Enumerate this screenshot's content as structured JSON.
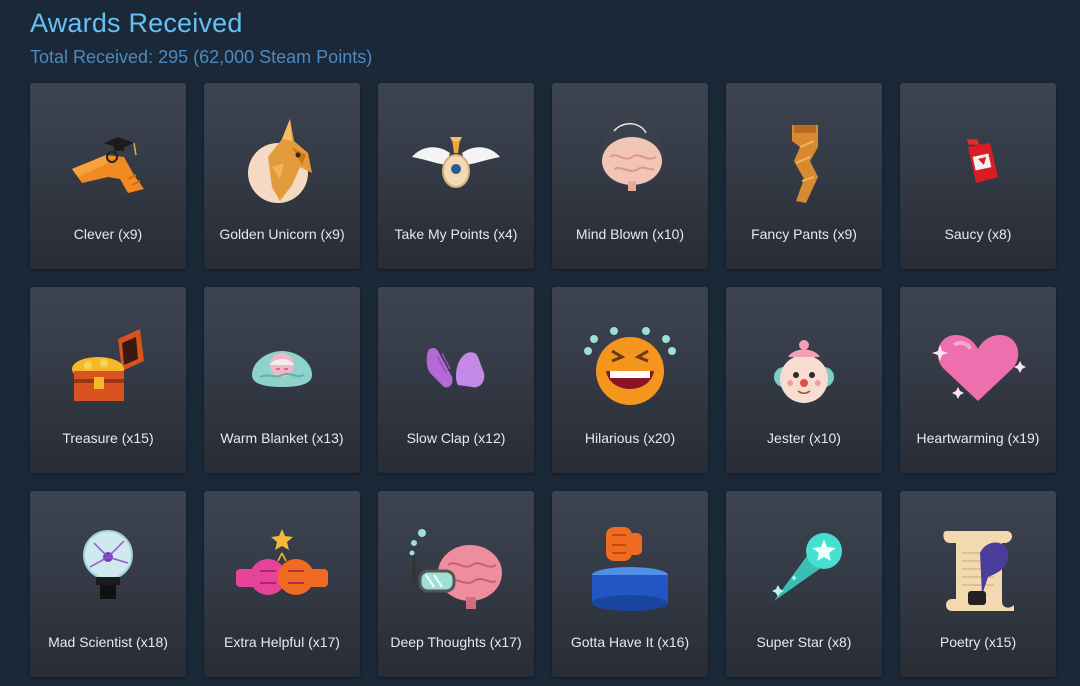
{
  "header": {
    "title": "Awards Received",
    "total": "Total Received: 295 (62,000 Steam Points)"
  },
  "awards": [
    {
      "label": "Clever (x9)",
      "icon": "clever-icon"
    },
    {
      "label": "Golden Unicorn (x9)",
      "icon": "golden-unicorn-icon"
    },
    {
      "label": "Take My Points (x4)",
      "icon": "take-my-points-icon"
    },
    {
      "label": "Mind Blown (x10)",
      "icon": "mind-blown-icon"
    },
    {
      "label": "Fancy Pants (x9)",
      "icon": "fancy-pants-icon"
    },
    {
      "label": "Saucy (x8)",
      "icon": "saucy-icon"
    },
    {
      "label": "Treasure (x15)",
      "icon": "treasure-icon"
    },
    {
      "label": "Warm Blanket (x13)",
      "icon": "warm-blanket-icon"
    },
    {
      "label": "Slow Clap (x12)",
      "icon": "slow-clap-icon"
    },
    {
      "label": "Hilarious (x20)",
      "icon": "hilarious-icon"
    },
    {
      "label": "Jester (x10)",
      "icon": "jester-icon"
    },
    {
      "label": "Heartwarming (x19)",
      "icon": "heartwarming-icon"
    },
    {
      "label": "Mad Scientist (x18)",
      "icon": "mad-scientist-icon"
    },
    {
      "label": "Extra Helpful (x17)",
      "icon": "extra-helpful-icon"
    },
    {
      "label": "Deep Thoughts (x17)",
      "icon": "deep-thoughts-icon"
    },
    {
      "label": "Gotta Have It (x16)",
      "icon": "gotta-have-it-icon"
    },
    {
      "label": "Super Star (x8)",
      "icon": "super-star-icon"
    },
    {
      "label": "Poetry (x15)",
      "icon": "poetry-icon"
    }
  ],
  "colors": {
    "background": "#1b2838",
    "title": "#66c0f4",
    "subtitle": "#4b8ac0",
    "label": "#e6eaef"
  }
}
